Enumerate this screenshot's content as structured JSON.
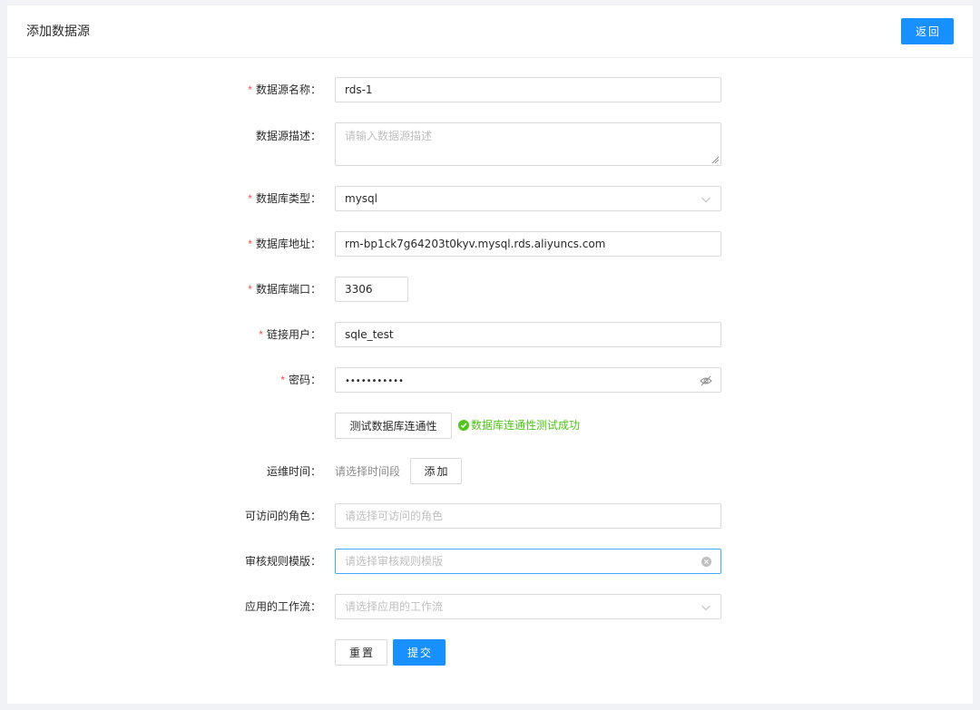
{
  "header": {
    "title": "添加数据源",
    "back_label": "返回"
  },
  "form": {
    "fields": {
      "name": {
        "label": "数据源名称",
        "required": true,
        "value": "rds-1"
      },
      "desc": {
        "label": "数据源描述",
        "required": false,
        "placeholder": "请输入数据源描述"
      },
      "db_type": {
        "label": "数据库类型",
        "required": true,
        "value": "mysql"
      },
      "host": {
        "label": "数据库地址",
        "required": true,
        "value": "rm-bp1ck7g64203t0kyv.mysql.rds.aliyuncs.com"
      },
      "port": {
        "label": "数据库端口",
        "required": true,
        "value": "3306"
      },
      "user": {
        "label": "链接用户",
        "required": true,
        "value": "sqle_test"
      },
      "password": {
        "label": "密码",
        "required": true,
        "value": "•••••••••••"
      },
      "maintenance": {
        "label": "运维时间",
        "placeholder": "请选择时间段",
        "add_label": "添加"
      },
      "roles": {
        "label": "可访问的角色",
        "placeholder": "请选择可访问的角色"
      },
      "rule_template": {
        "label": "审核规则模版",
        "placeholder": "请选择审核规则模版"
      },
      "workflow": {
        "label": "应用的工作流",
        "placeholder": "请选择应用的工作流"
      }
    },
    "test_connection_label": "测试数据库连通性",
    "test_result": "数据库连通性测试成功",
    "label_colon": "：",
    "required_mark": "*",
    "reset_label": "重置",
    "submit_label": "提交"
  },
  "colors": {
    "primary": "#1890ff",
    "success": "#52c41a",
    "required": "#ff4d4f",
    "border": "#d9d9d9",
    "placeholder": "#bfbfbf"
  },
  "icons": {
    "select_arrow": "chevron-down-icon",
    "password_toggle": "eye-invisible-icon",
    "clear": "clear-circle-icon",
    "success": "check-circle-icon"
  }
}
